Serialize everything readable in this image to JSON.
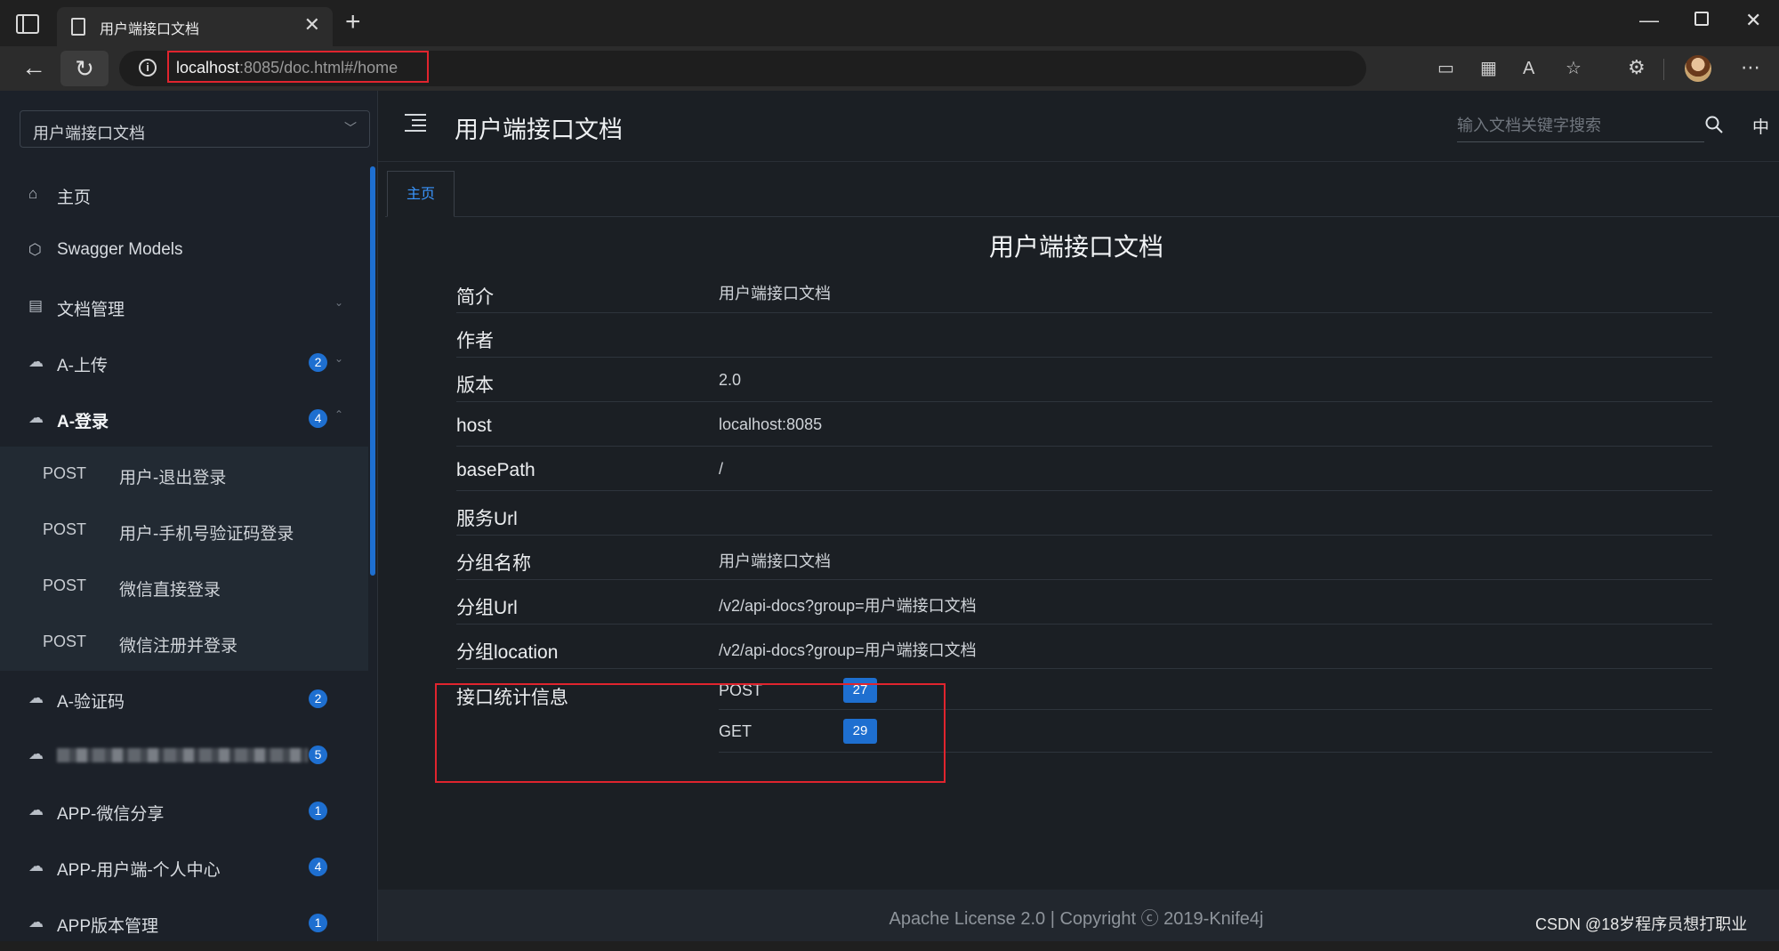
{
  "browser": {
    "tab_title": "用户端接口文档",
    "url_host": "localhost",
    "url_rest": ":8085/doc.html#/home"
  },
  "sidebar": {
    "group_select": "用户端接口文档",
    "items": [
      {
        "label": "主页",
        "icon": "home-icon"
      },
      {
        "label": "Swagger Models",
        "icon": "cube-icon"
      },
      {
        "label": "文档管理",
        "icon": "document-gear-icon"
      },
      {
        "label": "A-上传",
        "icon": "cloud-icon",
        "badge": "2"
      },
      {
        "label": "A-登录",
        "icon": "cloud-icon",
        "badge": "4",
        "expanded": true
      },
      {
        "label": "A-验证码",
        "icon": "cloud-icon",
        "badge": "2"
      },
      {
        "label": "",
        "icon": "cloud-icon",
        "badge": "5",
        "obscured": true
      },
      {
        "label": "APP-微信分享",
        "icon": "cloud-icon",
        "badge": "1"
      },
      {
        "label": "APP-用户端-个人中心",
        "icon": "cloud-icon",
        "badge": "4"
      },
      {
        "label": "APP版本管理",
        "icon": "cloud-icon",
        "badge": "1"
      }
    ],
    "subitems": [
      {
        "method": "POST",
        "label": "用户-退出登录"
      },
      {
        "method": "POST",
        "label": "用户-手机号验证码登录"
      },
      {
        "method": "POST",
        "label": "微信直接登录"
      },
      {
        "method": "POST",
        "label": "微信注册并登录"
      }
    ]
  },
  "header": {
    "title": "用户端接口文档",
    "search_placeholder": "输入文档关键字搜索",
    "lang": "中"
  },
  "tabs": {
    "home": "主页"
  },
  "doc": {
    "title": "用户端接口文档",
    "rows": [
      {
        "label": "简介",
        "value": "用户端接口文档"
      },
      {
        "label": "作者",
        "value": ""
      },
      {
        "label": "版本",
        "value": "2.0"
      },
      {
        "label": "host",
        "value": "localhost:8085"
      },
      {
        "label": "basePath",
        "value": "/"
      },
      {
        "label": "服务Url",
        "value": ""
      },
      {
        "label": "分组名称",
        "value": "用户端接口文档"
      },
      {
        "label": "分组Url",
        "value": "/v2/api-docs?group=用户端接口文档"
      },
      {
        "label": "分组location",
        "value": "/v2/api-docs?group=用户端接口文档"
      }
    ],
    "stats_label": "接口统计信息",
    "stats": [
      {
        "method": "POST",
        "count": "27"
      },
      {
        "method": "GET",
        "count": "29"
      }
    ]
  },
  "footer": {
    "text": "Apache License 2.0 | Copyright ⓒ 2019-Knife4j"
  },
  "watermark": "CSDN @18岁程序员想打职业",
  "colors": {
    "accent": "#1e6fd0",
    "highlight_box": "#e0242e",
    "tab_text": "#3a96ff"
  }
}
